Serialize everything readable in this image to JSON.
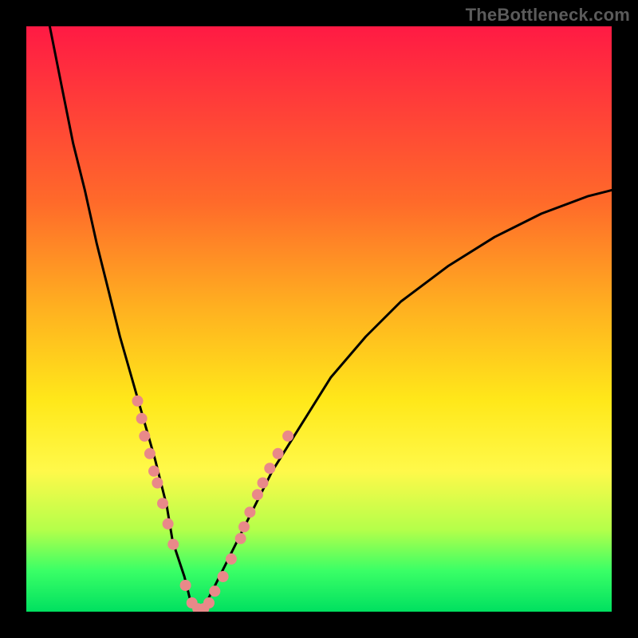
{
  "watermark": "TheBottleneck.com",
  "chart_data": {
    "type": "line",
    "title": "",
    "xlabel": "",
    "ylabel": "",
    "xlim": [
      0,
      100
    ],
    "ylim": [
      0,
      100
    ],
    "grid": false,
    "legend": false,
    "series": [
      {
        "name": "curve",
        "x": [
          4,
          6,
          8,
          10,
          12,
          14,
          16,
          18,
          20,
          22,
          24,
          25,
          27,
          28,
          29.5,
          31,
          34,
          38,
          42,
          47,
          52,
          58,
          64,
          72,
          80,
          88,
          96,
          100
        ],
        "y": [
          100,
          90,
          80,
          72,
          63,
          55,
          47,
          40,
          33,
          26,
          18,
          12,
          6,
          2,
          0,
          2,
          8,
          16,
          24,
          32,
          40,
          47,
          53,
          59,
          64,
          68,
          71,
          72
        ]
      }
    ],
    "markers": {
      "name": "dots",
      "color": "#e98989",
      "radius_px": 7,
      "points": [
        {
          "x": 19.0,
          "y": 36.0
        },
        {
          "x": 19.7,
          "y": 33.0
        },
        {
          "x": 20.2,
          "y": 30.0
        },
        {
          "x": 21.1,
          "y": 27.0
        },
        {
          "x": 21.8,
          "y": 24.0
        },
        {
          "x": 22.4,
          "y": 22.0
        },
        {
          "x": 23.3,
          "y": 18.5
        },
        {
          "x": 24.2,
          "y": 15.0
        },
        {
          "x": 25.1,
          "y": 11.5
        },
        {
          "x": 27.2,
          "y": 4.5
        },
        {
          "x": 28.3,
          "y": 1.5
        },
        {
          "x": 29.3,
          "y": 0.5
        },
        {
          "x": 30.3,
          "y": 0.5
        },
        {
          "x": 31.2,
          "y": 1.5
        },
        {
          "x": 32.2,
          "y": 3.5
        },
        {
          "x": 33.6,
          "y": 6.0
        },
        {
          "x": 35.0,
          "y": 9.0
        },
        {
          "x": 36.6,
          "y": 12.5
        },
        {
          "x": 37.2,
          "y": 14.5
        },
        {
          "x": 38.2,
          "y": 17.0
        },
        {
          "x": 39.5,
          "y": 20.0
        },
        {
          "x": 40.4,
          "y": 22.0
        },
        {
          "x": 41.6,
          "y": 24.5
        },
        {
          "x": 43.0,
          "y": 27.0
        },
        {
          "x": 44.7,
          "y": 30.0
        }
      ]
    },
    "colors": {
      "gradient": [
        "#ff1a44",
        "#ff3a3a",
        "#ff6a2a",
        "#ffb020",
        "#ffe81a",
        "#fff94a",
        "#b4ff4a",
        "#3aff66",
        "#00e060"
      ],
      "curve": "#000000",
      "marker": "#e98989",
      "frame": "#000000"
    }
  }
}
